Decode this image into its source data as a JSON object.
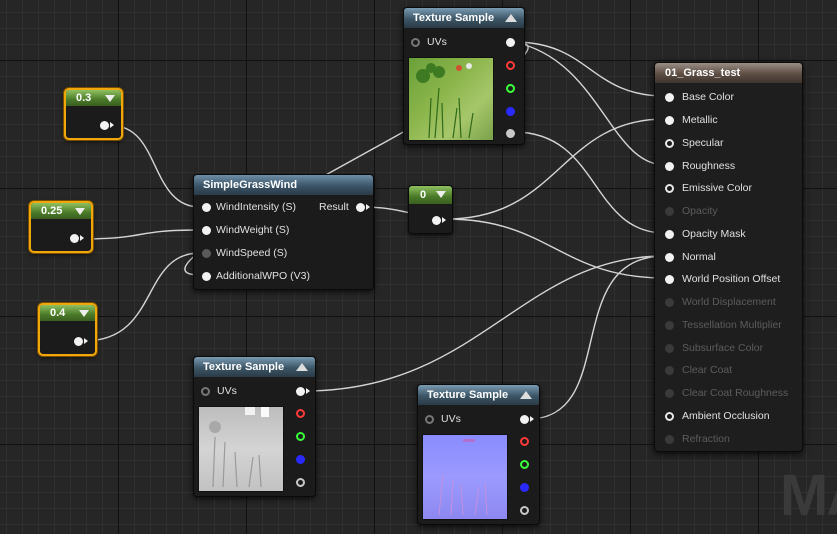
{
  "texture_sample_label": "Texture Sample",
  "uvs_label": "UVs",
  "constants": [
    "0.3",
    "0.25",
    "0.4"
  ],
  "zero_node": {
    "value": "0"
  },
  "grass_wind": {
    "title": "SimpleGrassWind",
    "inputs": [
      "WindIntensity (S)",
      "WindWeight (S)",
      "WindSpeed (S)",
      "AdditionalWPO (V3)"
    ],
    "output": "Result"
  },
  "material": {
    "title": "01_Grass_test",
    "pins": [
      "Base Color",
      "Metallic",
      "Specular",
      "Roughness",
      "Emissive Color",
      "Opacity",
      "Opacity Mask",
      "Normal",
      "World Position Offset",
      "World Displacement",
      "Tessellation Multiplier",
      "Subsurface Color",
      "Clear Coat",
      "Clear Coat Roughness",
      "Ambient Occlusion",
      "Refraction"
    ]
  },
  "channel_colors": {
    "r": "#ff3a3a",
    "g": "#3aff3a",
    "b": "#3a3aff",
    "a": "#c8c8c8"
  },
  "watermark": "MA"
}
